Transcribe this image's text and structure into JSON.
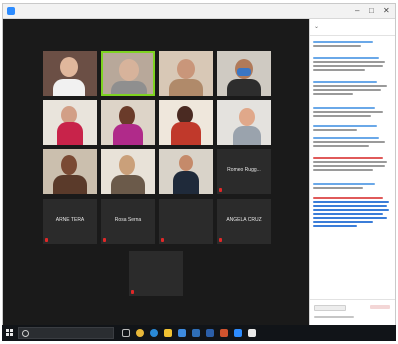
{
  "window": {
    "title": "",
    "minimize_glyph": "–",
    "maximize_glyph": "□",
    "close_glyph": "✕"
  },
  "tiles": [
    {
      "name": "",
      "speaking": false
    },
    {
      "name": "",
      "speaking": true
    },
    {
      "name": "",
      "speaking": false
    },
    {
      "name": "",
      "speaking": false
    },
    {
      "name": "",
      "speaking": false
    },
    {
      "name": "",
      "speaking": false
    },
    {
      "name": "",
      "speaking": false
    },
    {
      "name": "",
      "speaking": false
    },
    {
      "name": "",
      "speaking": false
    },
    {
      "name": "",
      "speaking": false
    },
    {
      "name": "",
      "speaking": false
    }
  ],
  "name_tiles": [
    {
      "name": "Romeo Rugg..."
    },
    {
      "name": "ARNE TERA"
    },
    {
      "name": "Rosa Serna"
    },
    {
      "name": ""
    },
    {
      "name": "ANGELA CRUZ"
    },
    {
      "name": ""
    }
  ],
  "chat": {
    "title": ""
  },
  "taskbar": {
    "search_placeholder": "",
    "time": "",
    "date": ""
  },
  "colors": {
    "speaking_border": "#7ed321",
    "mute_indicator": "#e02828",
    "chat_link": "#3b7dd8",
    "taskbar": "#111418"
  }
}
